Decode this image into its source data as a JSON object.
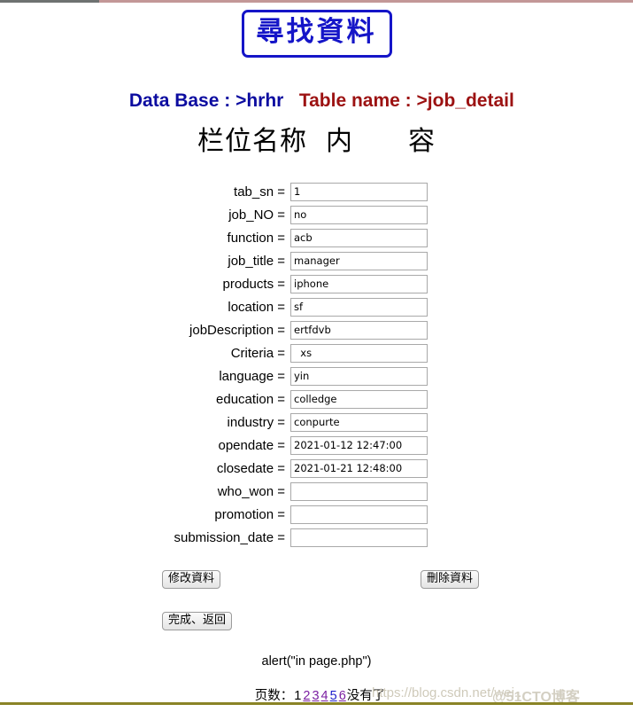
{
  "page": {
    "title_plaque": "尋找資料",
    "database_label": "Data Base : >",
    "database_value": "hrhr",
    "table_label": "Table name : >",
    "table_value": "job_detail",
    "column_heading": "栏位名称  内　　容"
  },
  "fields": [
    {
      "label": "tab_sn =",
      "value": "1"
    },
    {
      "label": "job_NO =",
      "value": "no"
    },
    {
      "label": "function =",
      "value": "acb"
    },
    {
      "label": "job_title =",
      "value": "manager"
    },
    {
      "label": "products =",
      "value": "iphone"
    },
    {
      "label": "location =",
      "value": "sf"
    },
    {
      "label": "jobDescription =",
      "value": "ertfdvb"
    },
    {
      "label": "Criteria =",
      "value": "  xs"
    },
    {
      "label": "language =",
      "value": "yin"
    },
    {
      "label": "education =",
      "value": "colledge"
    },
    {
      "label": "industry =",
      "value": "conpurte"
    },
    {
      "label": "opendate =",
      "value": "2021-01-12 12:47:00"
    },
    {
      "label": "closedate =",
      "value": "2021-01-21 12:48:00"
    },
    {
      "label": "who_won =",
      "value": ""
    },
    {
      "label": "promotion =",
      "value": ""
    },
    {
      "label": "submission_date =",
      "value": ""
    }
  ],
  "buttons": {
    "modify": "修改資料",
    "delete": "刪除資料",
    "done": "完成、返回"
  },
  "footer": {
    "alert_text": "alert(\"in page.php\")",
    "pager_label": "页数：",
    "pages": [
      {
        "num": "1",
        "current": true,
        "blue": false
      },
      {
        "num": "2",
        "current": false,
        "blue": false
      },
      {
        "num": "3",
        "current": false,
        "blue": false
      },
      {
        "num": "4",
        "current": false,
        "blue": false
      },
      {
        "num": "5",
        "current": false,
        "blue": true
      },
      {
        "num": "6",
        "current": false,
        "blue": false
      }
    ],
    "pager_tail": "没有了"
  },
  "watermarks": {
    "csdn": "https://blog.csdn.net/wei...",
    "cto": "@51CTO博客"
  },
  "colors": {
    "title_blue": "#1515c8",
    "db_blue": "#0c0ca0",
    "table_red": "#9c1212",
    "link_purple": "#7b1fa2",
    "link_blue": "#2222cc",
    "rule_olive": "#8a8426"
  }
}
